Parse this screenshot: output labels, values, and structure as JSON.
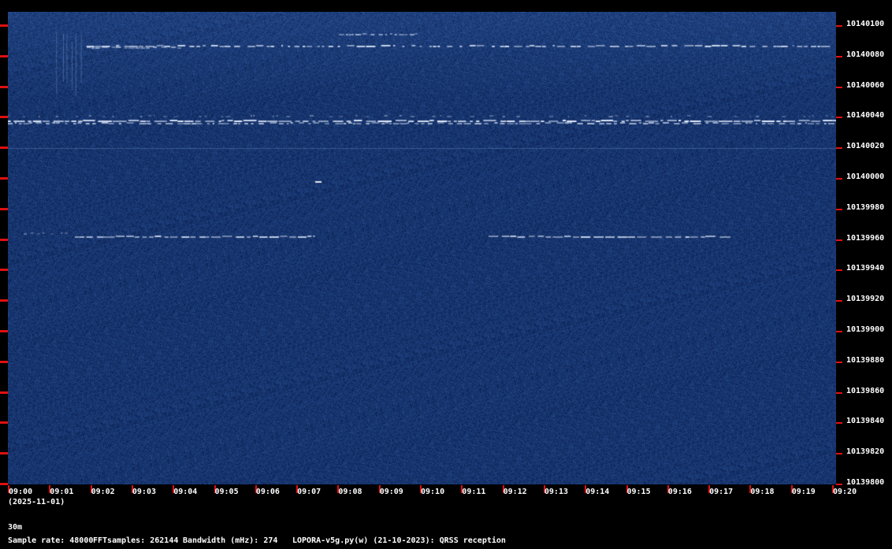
{
  "chart_data": {
    "type": "heatmap",
    "date": "(2025-11-01)",
    "y_ticks": [
      "10140100",
      "10140080",
      "10140060",
      "10140040",
      "10140020",
      "10140000",
      "10139980",
      "10139960",
      "10139940",
      "10139920",
      "10139900",
      "10139880",
      "10139860",
      "10139840",
      "10139820",
      "10139800"
    ],
    "x_ticks": [
      "09:00",
      "09:01",
      "09:02",
      "09:03",
      "09:04",
      "09:05",
      "09:06",
      "09:07",
      "09:08",
      "09:09",
      "09:10",
      "09:11",
      "09:12",
      "09:13",
      "09:14",
      "09:15",
      "09:16",
      "09:17",
      "09:18",
      "09:19",
      "09:20"
    ],
    "colors": {
      "background": "#0d2a5e",
      "signal": "#ffffff",
      "tick": "#e01010"
    }
  },
  "footer": {
    "band": "30m",
    "sample_rate": "Sample rate: 48000",
    "fft_samples": "FFTsamples: 262144",
    "bandwidth": "Bandwidth (mHz): 274",
    "software": "LOPORA-v5g.py(w) (21-10-2023): QRSS reception"
  }
}
